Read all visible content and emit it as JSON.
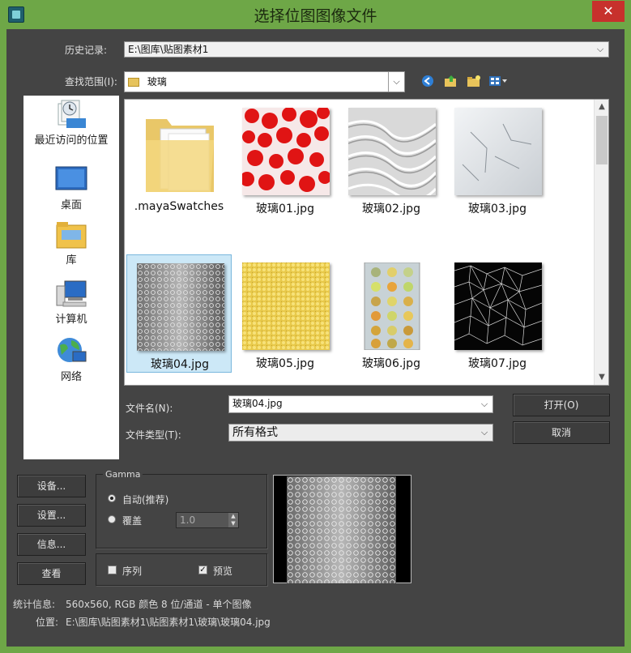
{
  "window": {
    "title": "选择位图图像文件",
    "close_glyph": "✕"
  },
  "history": {
    "label": "历史记录:",
    "value": "E:\\图库\\贴图素材1"
  },
  "lookin": {
    "label": "查找范围(I):",
    "value": "玻璃"
  },
  "toolbar": {
    "icons": [
      "back-icon",
      "up-folder-icon",
      "new-folder-icon",
      "view-menu-icon"
    ]
  },
  "places": [
    {
      "label": "最近访问的位置",
      "icon": "recent-places-icon"
    },
    {
      "label": "桌面",
      "icon": "desktop-icon"
    },
    {
      "label": "库",
      "icon": "libraries-icon"
    },
    {
      "label": "计算机",
      "icon": "computer-icon"
    },
    {
      "label": "网络",
      "icon": "network-icon"
    }
  ],
  "files": [
    {
      "name": ".mayaSwatches",
      "kind": "folder"
    },
    {
      "name": "玻璃01.jpg",
      "kind": "red"
    },
    {
      "name": "玻璃02.jpg",
      "kind": "wave"
    },
    {
      "name": "玻璃03.jpg",
      "kind": "crack"
    },
    {
      "name": "玻璃04.jpg",
      "kind": "dots",
      "selected": true
    },
    {
      "name": "玻璃05.jpg",
      "kind": "yellow"
    },
    {
      "name": "玻璃06.jpg",
      "kind": "grid"
    },
    {
      "name": "玻璃07.jpg",
      "kind": "mesh"
    }
  ],
  "filename": {
    "label": "文件名(N):",
    "value": "玻璃04.jpg"
  },
  "filetype": {
    "label": "文件类型(T):",
    "value": "所有格式"
  },
  "buttons": {
    "open": "打开(O)",
    "cancel": "取消"
  },
  "side_buttons": [
    "设备...",
    "设置...",
    "信息...",
    "查看"
  ],
  "gamma": {
    "title": "Gamma",
    "auto_label": "自动(推荐)",
    "override_label": "覆盖",
    "override_value": "1.0"
  },
  "options": {
    "sequence_label": "序列",
    "preview_label": "预览",
    "preview_checked": true
  },
  "stats": {
    "label": "统计信息:",
    "value": "560x560, RGB 颜色 8 位/通道 - 单个图像"
  },
  "location": {
    "label": "位置:",
    "value": "E:\\图库\\贴图素材1\\贴图素材1\\玻璃\\玻璃04.jpg"
  },
  "colors": {
    "title_bg": "#6ea747",
    "client_bg": "#444444",
    "close_bg": "#c7312c",
    "selection": "#cce8f7"
  }
}
